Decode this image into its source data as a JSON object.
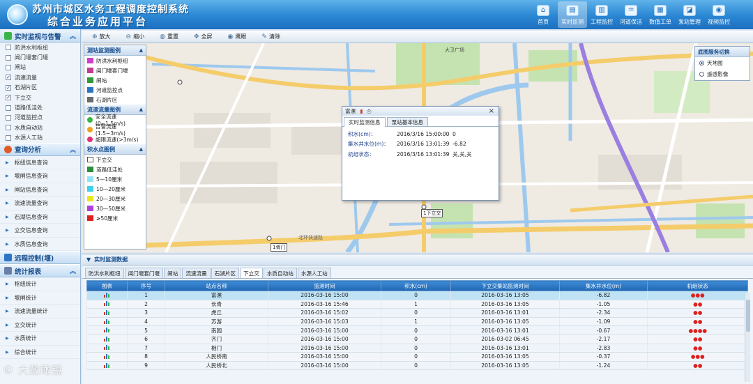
{
  "header": {
    "title_line1": "苏州市城区水务工程调度控制系统",
    "title_line2": "综合业务应用平台",
    "nav": [
      {
        "label": "首页",
        "icon": "home-icon",
        "glyph": "⌂",
        "active": false
      },
      {
        "label": "实时监测",
        "icon": "monitor-icon",
        "glyph": "▤",
        "active": true
      },
      {
        "label": "工程监控",
        "icon": "engineering-icon",
        "glyph": "▥",
        "active": false
      },
      {
        "label": "河道保洁",
        "icon": "river-clean-icon",
        "glyph": "♒",
        "active": false
      },
      {
        "label": "数值工单",
        "icon": "work-order-icon",
        "glyph": "▦",
        "active": false
      },
      {
        "label": "泵站管理",
        "icon": "pump-icon",
        "glyph": "◪",
        "active": false
      },
      {
        "label": "视频监控",
        "icon": "video-icon",
        "glyph": "◉",
        "active": false
      }
    ]
  },
  "sidebar": {
    "monitor_title": "实时监视与告警",
    "monitor_items": [
      {
        "label": "防洪水利枢纽",
        "checked": false
      },
      {
        "label": "阊门堰套门堰",
        "checked": false
      },
      {
        "label": "闸站",
        "checked": false
      },
      {
        "label": "流速流量",
        "checked": true
      },
      {
        "label": "石湖片区",
        "checked": true
      },
      {
        "label": "下立交",
        "checked": true
      },
      {
        "label": "道路低洼处",
        "checked": false
      },
      {
        "label": "河道监控点",
        "checked": false
      },
      {
        "label": "水质自动站",
        "checked": false
      },
      {
        "label": "水源人工站",
        "checked": false
      }
    ],
    "query_title": "查询分析",
    "query_items": [
      "枢纽信息查询",
      "堰闸信息查询",
      "闸站信息查询",
      "流速流量查询",
      "石湖信息查询",
      "立交信息查询",
      "水质信息查询"
    ],
    "remote_title": "远程控制(堰)",
    "report_title": "统计报表",
    "report_items": [
      "枢纽统计",
      "堰闸统计",
      "流速流量统计",
      "立交统计",
      "水质统计",
      "综合统计"
    ]
  },
  "toolbar": {
    "zoom_in": "放大",
    "zoom_out": "缩小",
    "reset": "重置",
    "fullscreen": "全屏",
    "eagle": "鹰眼",
    "clear": "清除"
  },
  "legend": {
    "station_title": "测站监测图例",
    "station_items": [
      {
        "label": "防洪水利枢纽",
        "color": "#d23cc9"
      },
      {
        "label": "阊门堰套门堰",
        "color": "#c43b91"
      },
      {
        "label": "闸站",
        "color": "#2f9a3a"
      },
      {
        "label": "河道监控点",
        "color": "#2c74c4"
      },
      {
        "label": "石湖片区",
        "color": "#6a6a6a"
      }
    ],
    "flow_title": "流速流量图例",
    "flow_items": [
      {
        "label": "安全流速(0~1.5m/s)",
        "color": "#3bb54a"
      },
      {
        "label": "告警流速(1.5~3m/s)",
        "color": "#f0a020"
      },
      {
        "label": "超限流速(>3m/s)",
        "color": "#e0307a"
      }
    ],
    "water_title": "积水点图例",
    "water_items": [
      {
        "label": "下立交",
        "color": "#ffffff"
      },
      {
        "label": "道路低洼处",
        "color": "#2a8f3a"
      },
      {
        "label": "5—10厘米",
        "color": "#8fe3f5"
      },
      {
        "label": "10—20厘米",
        "color": "#3fd0e8"
      },
      {
        "label": "20—30厘米",
        "color": "#e8e820"
      },
      {
        "label": "30—50厘米",
        "color": "#b040d8"
      },
      {
        "label": "≥50厘米",
        "color": "#e02020"
      }
    ]
  },
  "basemap": {
    "title": "底图服务切换",
    "options": [
      {
        "label": "天地图",
        "selected": true
      },
      {
        "label": "遥感影像",
        "selected": false
      }
    ]
  },
  "map_labels": {
    "place1": "大卫广场",
    "station1": "1胥门",
    "station2": "1下立交",
    "road1": "北环快速路"
  },
  "popup": {
    "title": "富漯",
    "tabs": [
      "实时监测信息",
      "泵站基本信息"
    ],
    "rows": [
      {
        "label": "积水(cm)：",
        "time": "2016/3/16 15:00:00",
        "value": "0"
      },
      {
        "label": "集水井水位(m)：",
        "time": "2016/3/16 13:01:39",
        "value": "-6.82"
      },
      {
        "label": "机组状态：",
        "time": "2016/3/16 13:01:39",
        "value": "关,关,关"
      }
    ]
  },
  "bottom": {
    "title": "实时监测数据",
    "tabs": [
      "防洪水利枢纽",
      "阊门堰套门堰",
      "闸站",
      "流速流量",
      "石湖片区",
      "下立交",
      "水质自动站",
      "水源人工站"
    ],
    "active_tab": "下立交",
    "columns": [
      "图表",
      "序号",
      "站点名称",
      "监测时间",
      "积水(cm)",
      "下立交集站监测时间",
      "集水井水位(m)",
      "机组状态"
    ],
    "rows": [
      {
        "no": "1",
        "name": "富漯",
        "time": "2016-03-16 15:00",
        "water": "0",
        "time2": "2016-03-16 13:05",
        "level": "-6.82",
        "status": "●●●"
      },
      {
        "no": "2",
        "name": "长青",
        "time": "2016-03-16 15:46",
        "water": "1",
        "time2": "2016-03-16 13:05",
        "level": "-1.05",
        "status": "●●"
      },
      {
        "no": "3",
        "name": "虎丘",
        "time": "2016-03-16 15:02",
        "water": "0",
        "time2": "2016-03-16 13:01",
        "level": "-2.34",
        "status": "●●"
      },
      {
        "no": "4",
        "name": "苏游",
        "time": "2016-03-16 15:03",
        "water": "1",
        "time2": "2016-03-16 13:05",
        "level": "-1.09",
        "status": "●●"
      },
      {
        "no": "5",
        "name": "南园",
        "time": "2016-03-16 15:00",
        "water": "0",
        "time2": "2016-03-16 13:01",
        "level": "-0.67",
        "status": "●●●●"
      },
      {
        "no": "6",
        "name": "齐门",
        "time": "2016-03-16 15:00",
        "water": "0",
        "time2": "2016-03-02 06:45",
        "level": "-2.17",
        "status": "●●"
      },
      {
        "no": "7",
        "name": "相门",
        "time": "2016-03-16 15:00",
        "water": "0",
        "time2": "2016-03-16 13:01",
        "level": "-2.83",
        "status": "●●"
      },
      {
        "no": "8",
        "name": "人民桥南",
        "time": "2016-03-16 15:00",
        "water": "0",
        "time2": "2016-03-16 13:05",
        "level": "-0.37",
        "status": "●●●"
      },
      {
        "no": "9",
        "name": "人民桥北",
        "time": "2016-03-16 15:00",
        "water": "0",
        "time2": "2016-03-16 13:05",
        "level": "-1.24",
        "status": "●●"
      }
    ]
  },
  "watermark": "© 大数瞰镜"
}
